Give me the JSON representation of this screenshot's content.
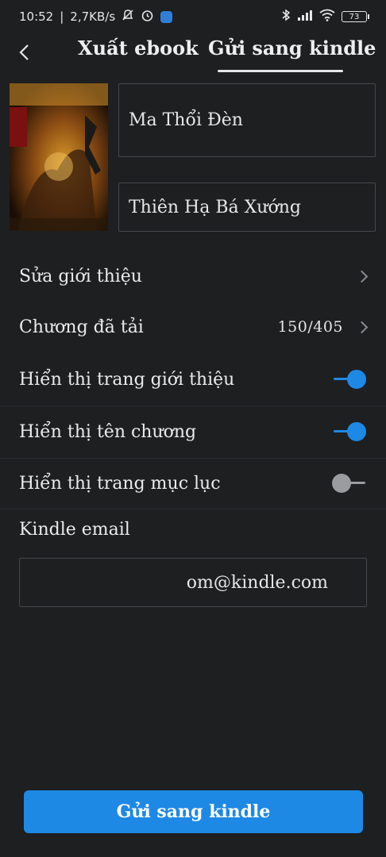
{
  "status_bar": {
    "time": "10:52",
    "network_speed": "2,7KB/s",
    "battery_level": "73"
  },
  "header": {
    "back_icon": "chevron-left-icon",
    "tabs": [
      {
        "label": "Xuất ebook",
        "active": false
      },
      {
        "label": "Gửi sang kindle",
        "active": true
      }
    ]
  },
  "book": {
    "cover_icon": "book-cover-image",
    "author": "Ma Thổi Đèn",
    "title": "Thiên Hạ Bá Xướng"
  },
  "settings": {
    "edit_intro_label": "Sửa giới thiệu",
    "downloaded_chapters_label": "Chương đã tải",
    "downloaded_chapters_value": "150/405",
    "show_intro_page_label": "Hiển thị trang giới thiệu",
    "show_intro_page_on": true,
    "show_chapter_name_label": "Hiển thị tên chương",
    "show_chapter_name_on": true,
    "show_toc_page_label": "Hiển thị trang mục lục",
    "show_toc_page_on": false
  },
  "kindle": {
    "email_label": "Kindle email",
    "email_value": "om@kindle.com"
  },
  "actions": {
    "send_button_label": "Gửi sang kindle"
  },
  "colors": {
    "background": "#1e1f21",
    "accent": "#1e88e5",
    "text": "#e6e6e6",
    "toggle_off": "#9a9ca0"
  }
}
